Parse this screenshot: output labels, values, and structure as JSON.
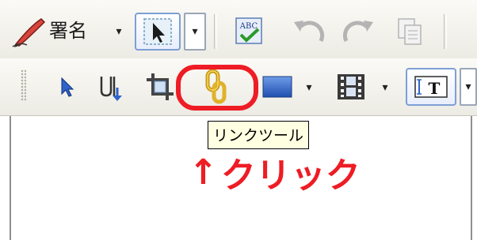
{
  "toolbar1": {
    "signature_label": "署名",
    "items": [
      {
        "name": "signature-pen-icon",
        "kind": "icon"
      },
      {
        "name": "signature-dropdown",
        "kind": "dropdown"
      },
      {
        "name": "select-stamp-button",
        "kind": "button",
        "state": "pressed"
      },
      {
        "name": "select-stamp-dropdown",
        "kind": "dropdown"
      },
      {
        "name": "spell-check-button",
        "kind": "button",
        "icon_text": "ABC"
      },
      {
        "name": "undo-button",
        "kind": "button",
        "state": "disabled"
      },
      {
        "name": "redo-button",
        "kind": "button",
        "state": "disabled"
      },
      {
        "name": "copy-button",
        "kind": "button",
        "state": "disabled"
      }
    ]
  },
  "toolbar2": {
    "items": [
      {
        "name": "select-tool-button",
        "kind": "button"
      },
      {
        "name": "touchup-text-tool-button",
        "kind": "button"
      },
      {
        "name": "crop-tool-button",
        "kind": "button"
      },
      {
        "name": "link-tool-button",
        "kind": "button",
        "state": "hover"
      },
      {
        "name": "rectangle-tool-button",
        "kind": "button"
      },
      {
        "name": "movie-tool-button",
        "kind": "button"
      },
      {
        "name": "text-field-tool-button",
        "kind": "button",
        "state": "pressed",
        "icon_text": "T"
      }
    ]
  },
  "tooltip": {
    "text": "リンクツール"
  },
  "annotation": {
    "arrow": "↑",
    "text": "クリック",
    "color": "#ee1c24"
  },
  "colors": {
    "highlight": "#ee1c24",
    "tooltip_bg": "#ffffe1",
    "toolbar_bg": "#ecebe4",
    "pressed_border": "#7d9fd6",
    "accent_blue": "#2f63c8"
  }
}
